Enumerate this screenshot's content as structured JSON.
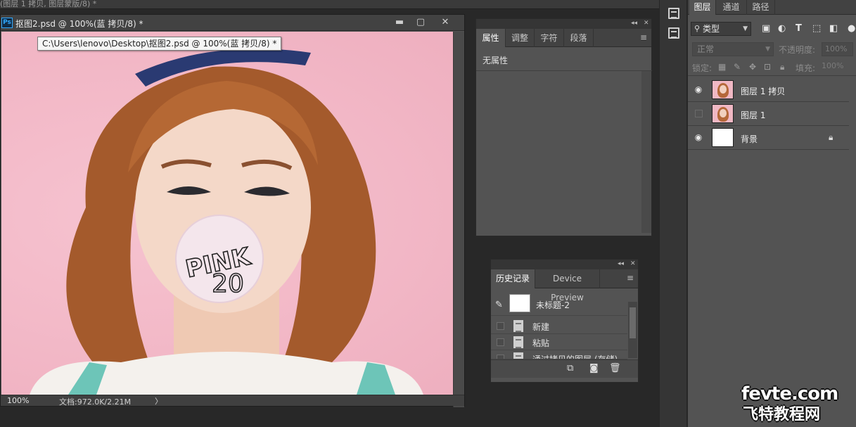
{
  "app": {
    "top_strip_text": "(图层 1 拷贝, 图层蒙版/8) *"
  },
  "document": {
    "title": "抠图2.psd @ 100%(蓝 拷贝/8) *",
    "tooltip": "C:\\Users\\lenovo\\Desktop\\抠图2.psd @ 100%(蓝 拷贝/8) *",
    "zoom_level": "100%",
    "doc_info": "文档:972.0K/2.21M",
    "bubble_text_line1": "PINK",
    "bubble_text_line2": "20",
    "window_buttons": {
      "minimize": "▬",
      "maximize": "▢",
      "close": "✕"
    }
  },
  "properties_panel": {
    "tabs": [
      {
        "label": "属性",
        "active": true
      },
      {
        "label": "调整",
        "active": false
      },
      {
        "label": "字符",
        "active": false
      },
      {
        "label": "段落",
        "active": false
      }
    ],
    "empty_text": "无属性"
  },
  "history_panel": {
    "tabs": [
      {
        "label": "历史记录",
        "active": true
      },
      {
        "label": "Device Preview",
        "active": false
      }
    ],
    "snapshot_label": "未标题-2",
    "states": [
      {
        "label": "新建"
      },
      {
        "label": "粘贴"
      },
      {
        "label": "通过拷贝的图层 (存储)"
      }
    ]
  },
  "layers_panel": {
    "tabs": [
      {
        "label": "图层",
        "active": true
      },
      {
        "label": "通道",
        "active": false
      },
      {
        "label": "路径",
        "active": false
      }
    ],
    "filter_type": "类型",
    "blend_mode": "正常",
    "opacity_label": "不透明度:",
    "opacity_value": "100%",
    "lock_label": "锁定:",
    "fill_label": "填充:",
    "fill_value": "100%",
    "layers": [
      {
        "name": "图层 1 拷贝",
        "visible": true,
        "thumb": "photo",
        "locked": false
      },
      {
        "name": "图层 1",
        "visible": false,
        "thumb": "photo",
        "locked": false
      },
      {
        "name": "背景",
        "visible": true,
        "thumb": "white",
        "locked": true
      }
    ]
  },
  "watermark": {
    "line1": "fevte.com",
    "line2": "飞特教程网"
  },
  "colors": {
    "panel_bg": "#535353",
    "canvas_bg": "#f2b7c6",
    "accent_ps": "#31a8ff"
  }
}
